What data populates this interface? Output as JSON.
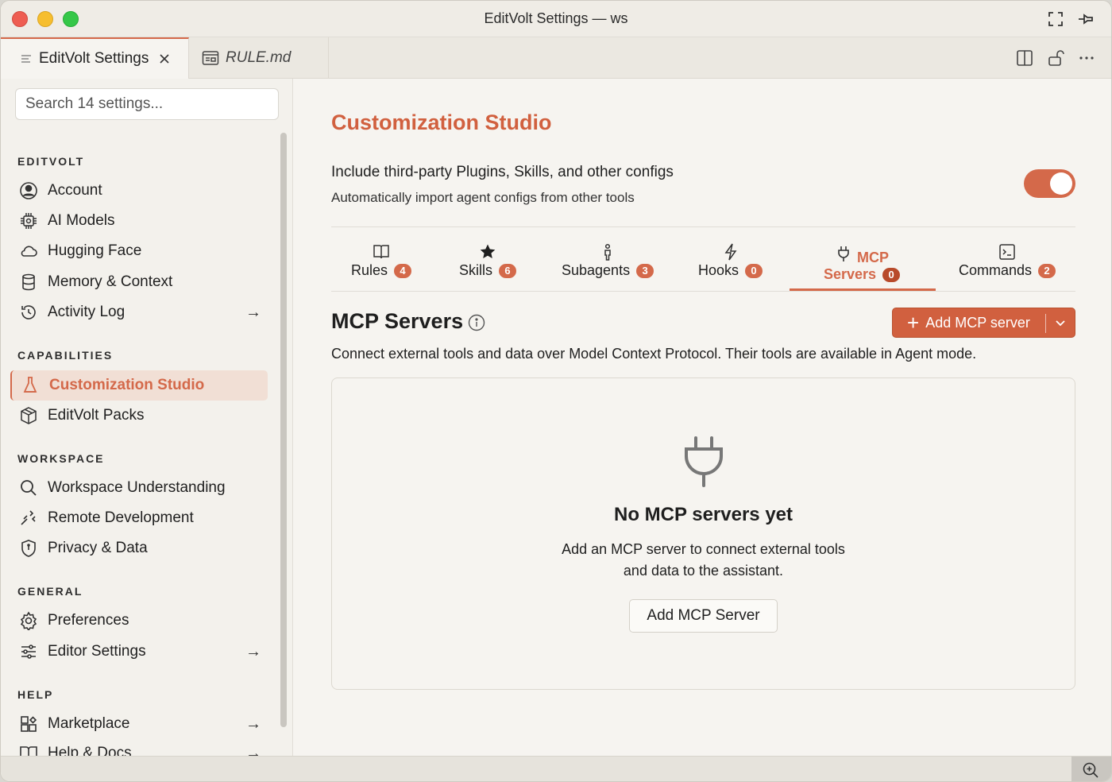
{
  "window": {
    "title": "EditVolt Settings — ws"
  },
  "tabs": [
    {
      "label": "EditVolt Settings",
      "active": true
    },
    {
      "label": "RULE.md",
      "active": false
    }
  ],
  "sidebar": {
    "search_placeholder": "Search 14 settings...",
    "sections": [
      {
        "label": "EDITVOLT",
        "items": [
          {
            "label": "Account",
            "icon": "account-icon"
          },
          {
            "label": "AI Models",
            "icon": "chip-icon"
          },
          {
            "label": "Hugging Face",
            "icon": "cloud-icon"
          },
          {
            "label": "Memory & Context",
            "icon": "database-icon"
          },
          {
            "label": "Activity Log",
            "icon": "history-icon",
            "arrow": "→"
          }
        ]
      },
      {
        "label": "CAPABILITIES",
        "items": [
          {
            "label": "Customization Studio",
            "icon": "flask-icon",
            "selected": true
          },
          {
            "label": "EditVolt Packs",
            "icon": "package-icon"
          }
        ]
      },
      {
        "label": "WORKSPACE",
        "items": [
          {
            "label": "Workspace Understanding",
            "icon": "search-icon"
          },
          {
            "label": "Remote Development",
            "icon": "remote-icon"
          },
          {
            "label": "Privacy & Data",
            "icon": "shield-icon"
          }
        ]
      },
      {
        "label": "GENERAL",
        "items": [
          {
            "label": "Preferences",
            "icon": "gear-icon"
          },
          {
            "label": "Editor Settings",
            "icon": "sliders-icon",
            "arrow": "→"
          }
        ]
      },
      {
        "label": "HELP",
        "items": [
          {
            "label": "Marketplace",
            "icon": "extensions-icon",
            "arrow": "→"
          },
          {
            "label": "Help & Docs",
            "icon": "book-icon",
            "arrow": "→"
          }
        ]
      }
    ]
  },
  "main": {
    "title": "Customization Studio",
    "setting": {
      "title": "Include third-party Plugins, Skills, and other configs",
      "description": "Automatically import agent configs from other tools",
      "enabled": true
    },
    "subtabs": [
      {
        "label": "Rules",
        "count": "4",
        "icon": "book-icon"
      },
      {
        "label": "Skills",
        "count": "6",
        "icon": "star-icon"
      },
      {
        "label": "Subagents",
        "count": "3",
        "icon": "person-icon"
      },
      {
        "label": "Hooks",
        "count": "0",
        "icon": "bolt-icon"
      },
      {
        "label_line1": "MCP",
        "label_line2": "Servers",
        "count": "0",
        "icon": "plug-icon",
        "active": true
      },
      {
        "label": "Commands",
        "count": "2",
        "icon": "terminal-icon"
      }
    ],
    "section": {
      "title": "MCP Servers",
      "add_button": "Add MCP server",
      "description": "Connect external tools and data over Model Context Protocol. Their tools are available in Agent mode."
    },
    "empty": {
      "title": "No MCP servers yet",
      "line1": "Add an MCP server to connect external tools",
      "line2": "and data to the assistant.",
      "button": "Add MCP Server"
    }
  },
  "colors": {
    "accent": "#d1603f",
    "background": "#f6f4f0"
  }
}
